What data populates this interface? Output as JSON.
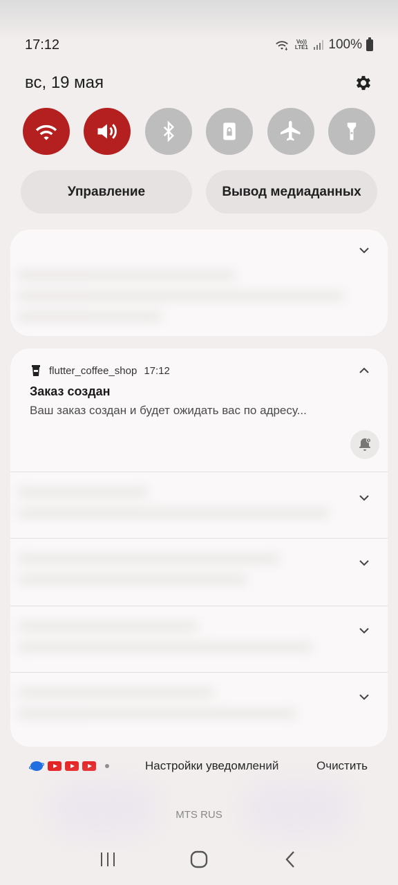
{
  "status_bar": {
    "time": "17:12",
    "volte": "Vo)) LTE1",
    "battery": "100%"
  },
  "header": {
    "date": "вс, 19 мая"
  },
  "quick_toggles": [
    {
      "name": "wifi",
      "active": true
    },
    {
      "name": "sound",
      "active": true
    },
    {
      "name": "bluetooth",
      "active": false
    },
    {
      "name": "rotation-lock",
      "active": false
    },
    {
      "name": "airplane",
      "active": false
    },
    {
      "name": "flashlight",
      "active": false
    }
  ],
  "pills": {
    "control": "Управление",
    "media_output": "Вывод медиаданных"
  },
  "notification": {
    "app_name": "flutter_coffee_shop",
    "time": "17:12",
    "title": "Заказ создан",
    "body": "Ваш заказ создан и будет ожидать вас по адресу..."
  },
  "footer": {
    "settings_label": "Настройки уведомлений",
    "clear_label": "Очистить"
  },
  "carrier": "MTS RUS",
  "colors": {
    "accent": "#b3201f",
    "inactive": "#bdbdbd",
    "card": "#faf8f8"
  }
}
